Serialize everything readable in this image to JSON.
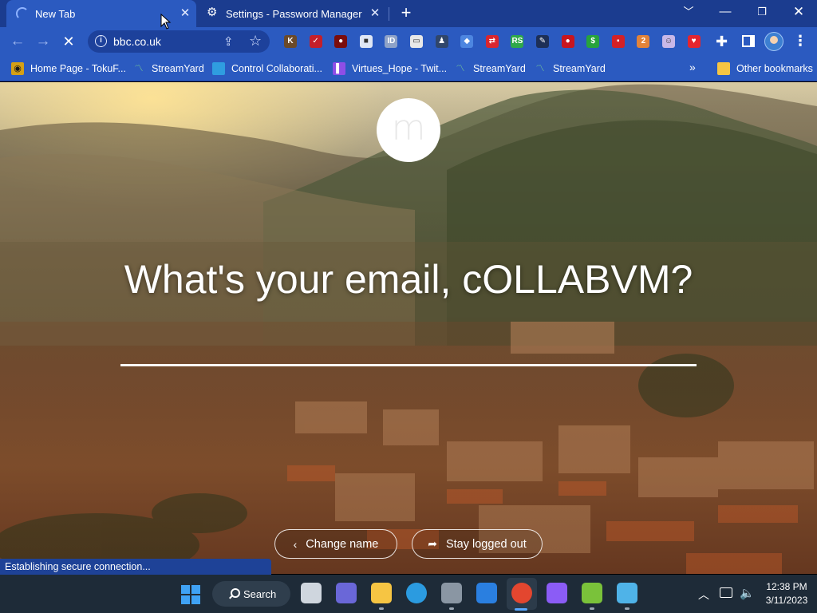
{
  "browser": {
    "tabs": [
      {
        "title": "New Tab",
        "state": "loading"
      },
      {
        "title": "Settings - Password Manager",
        "icon": "gear-icon"
      }
    ],
    "url": "bbc.co.uk",
    "status_text": "Establishing secure connection...",
    "extensions": [
      {
        "name": "k-extension",
        "glyph": "K",
        "color": "#6b4a2a"
      },
      {
        "name": "red-slash-extension",
        "glyph": "✓",
        "color": "#c41f2a"
      },
      {
        "name": "record-extension",
        "glyph": "●",
        "color": "#7a0d0d"
      },
      {
        "name": "white-square-extension",
        "glyph": "■",
        "color": "#dfe6f5"
      },
      {
        "name": "id-extension",
        "glyph": "ID",
        "color": "#8ea2c8"
      },
      {
        "name": "label-extension",
        "glyph": "▭",
        "color": "#e8e8e8"
      },
      {
        "name": "stamp-extension",
        "glyph": "♟",
        "color": "#30466b"
      },
      {
        "name": "blue-cube-extension",
        "glyph": "◆",
        "color": "#4d86e0"
      },
      {
        "name": "arrows-extension",
        "glyph": "⇄",
        "color": "#d9262e"
      },
      {
        "name": "rs-extension",
        "glyph": "RS",
        "color": "#2fa84a"
      },
      {
        "name": "pen-extension",
        "glyph": "✎",
        "color": "#1d2f57"
      },
      {
        "name": "red-blob-extension",
        "glyph": "●",
        "color": "#c8151e"
      },
      {
        "name": "dollar-extension",
        "glyph": "$",
        "color": "#27a33c"
      },
      {
        "name": "red-chat-extension",
        "glyph": "▪",
        "color": "#d32127"
      },
      {
        "name": "badge-extension",
        "glyph": "2",
        "color": "#e2833a"
      },
      {
        "name": "character-extension",
        "glyph": "☺",
        "color": "#c9b8e8"
      },
      {
        "name": "youtube-heart-extension",
        "glyph": "♥",
        "color": "#e4252f"
      }
    ]
  },
  "bookmarks": [
    {
      "label": "Home Page - TokuF...",
      "icon": "tokufan-icon",
      "color": "#d4a017"
    },
    {
      "label": "StreamYard",
      "icon": "streamyard-icon",
      "color": "#3aa35a"
    },
    {
      "label": "Control Collaborati...",
      "icon": "monitor-icon",
      "color": "#2f9de0"
    },
    {
      "label": "Virtues_Hope - Twit...",
      "icon": "twitch-icon",
      "color": "#8e4ee6"
    },
    {
      "label": "StreamYard",
      "icon": "streamyard-icon",
      "color": "#3aa35a"
    },
    {
      "label": "StreamYard",
      "icon": "streamyard-icon",
      "color": "#3aa35a"
    }
  ],
  "other_bookmarks": "Other bookmarks",
  "page": {
    "logo_letter": "m",
    "heading": "What's your email, cOLLABVM?",
    "email_value": "",
    "change_name": "Change name",
    "stay_logged_out": "Stay logged out"
  },
  "taskbar": {
    "search_label": "Search",
    "time": "12:38 PM",
    "date": "3/11/2023",
    "apps": [
      {
        "name": "task-view-icon",
        "color": "#cfd6de",
        "running": false
      },
      {
        "name": "teams-chat-icon",
        "color": "#6a67d8",
        "running": false
      },
      {
        "name": "file-explorer-icon",
        "color": "#f6c543",
        "running": true
      },
      {
        "name": "edge-icon",
        "color": "#2b9be0",
        "running": false
      },
      {
        "name": "settings-gear-icon",
        "color": "#8a96a3",
        "running": true
      },
      {
        "name": "microsoft-store-icon",
        "color": "#2a7fe0",
        "running": false
      },
      {
        "name": "chrome-icon",
        "color": "#e3462f",
        "running": true
      },
      {
        "name": "visual-studio-icon",
        "color": "#8b5cf6",
        "running": false
      },
      {
        "name": "frog-app-icon",
        "color": "#7ac23a",
        "running": true
      },
      {
        "name": "control-panel-icon",
        "color": "#4fb3e8",
        "running": true
      }
    ]
  }
}
